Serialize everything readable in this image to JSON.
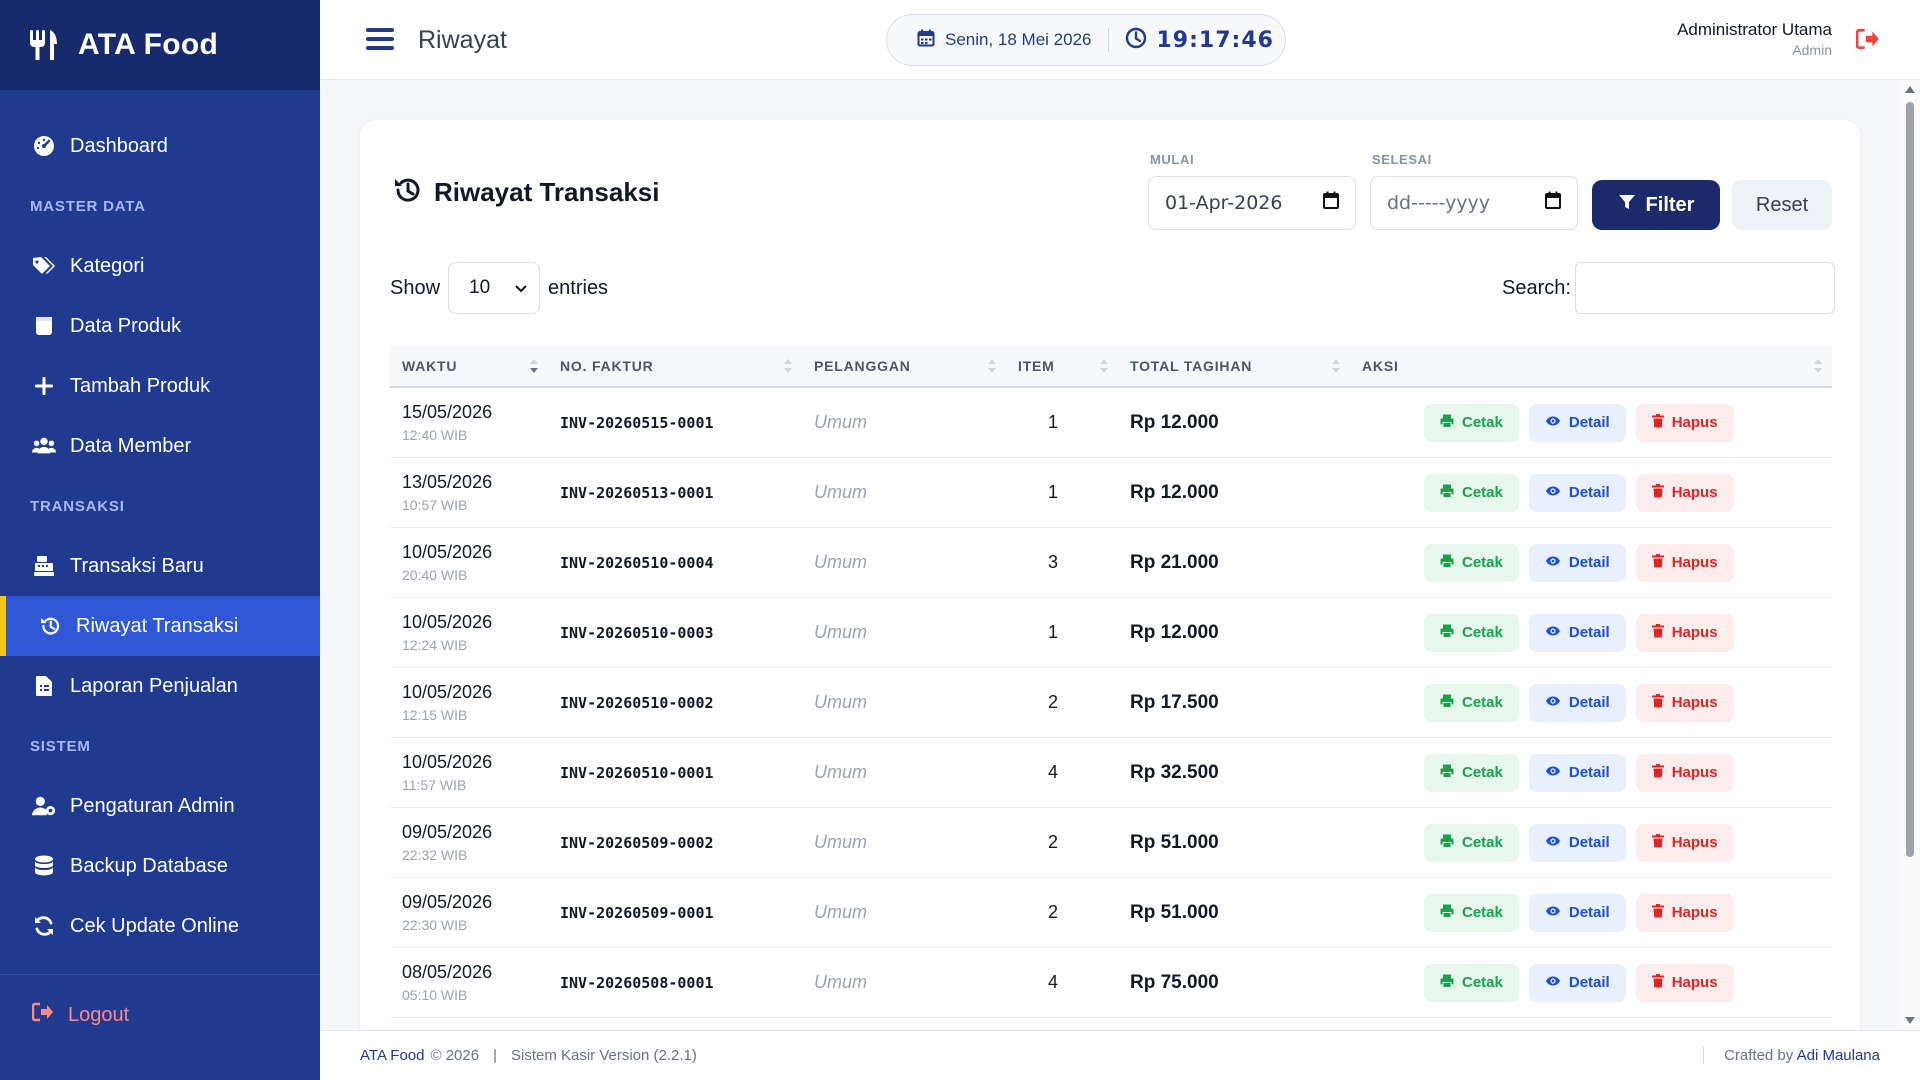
{
  "brand": {
    "name": "ATA Food",
    "icon": "utensils-icon"
  },
  "sidebar": {
    "items": [
      {
        "type": "item",
        "label": "Dashboard",
        "icon": "dashboard-icon"
      },
      {
        "type": "section",
        "label": "MASTER DATA"
      },
      {
        "type": "item",
        "label": "Kategori",
        "icon": "tags-icon"
      },
      {
        "type": "item",
        "label": "Data Produk",
        "icon": "box-icon"
      },
      {
        "type": "item",
        "label": "Tambah Produk",
        "icon": "plus-icon"
      },
      {
        "type": "item",
        "label": "Data Member",
        "icon": "users-icon"
      },
      {
        "type": "section",
        "label": "TRANSAKSI"
      },
      {
        "type": "item",
        "label": "Transaksi Baru",
        "icon": "cash-register-icon"
      },
      {
        "type": "item",
        "label": "Riwayat Transaksi",
        "icon": "history-icon",
        "active": true
      },
      {
        "type": "item",
        "label": "Laporan Penjualan",
        "icon": "file-report-icon"
      },
      {
        "type": "section",
        "label": "SISTEM"
      },
      {
        "type": "item",
        "label": "Pengaturan Admin",
        "icon": "user-gear-icon"
      },
      {
        "type": "item",
        "label": "Backup Database",
        "icon": "database-icon"
      },
      {
        "type": "item",
        "label": "Cek Update Online",
        "icon": "sync-icon"
      }
    ],
    "logout_label": "Logout"
  },
  "topbar": {
    "title": "Riwayat",
    "date": "Senin, 18 Mei 2026",
    "time": "19:17:46",
    "user_name": "Administrator Utama",
    "user_role": "Admin"
  },
  "card": {
    "title": "Riwayat Transaksi",
    "start_label": "MULAI",
    "start_value": "01-Apr-2026",
    "end_label": "SELESAI",
    "end_placeholder": "dd-----yyyy",
    "filter_label": "Filter",
    "reset_label": "Reset",
    "show_label": "Show",
    "entries_value": "10",
    "entries_label": "entries",
    "search_label": "Search:"
  },
  "table": {
    "headers": [
      "WAKTU",
      "NO. FAKTUR",
      "PELANGGAN",
      "ITEM",
      "TOTAL TAGIHAN",
      "AKSI"
    ],
    "action_labels": {
      "print": "Cetak",
      "detail": "Detail",
      "delete": "Hapus"
    },
    "rows": [
      {
        "date": "15/05/2026",
        "time": "12:40 WIB",
        "invoice": "INV-20260515-0001",
        "customer": "Umum",
        "items": "1",
        "total": "Rp 12.000"
      },
      {
        "date": "13/05/2026",
        "time": "10:57 WIB",
        "invoice": "INV-20260513-0001",
        "customer": "Umum",
        "items": "1",
        "total": "Rp 12.000"
      },
      {
        "date": "10/05/2026",
        "time": "20:40 WIB",
        "invoice": "INV-20260510-0004",
        "customer": "Umum",
        "items": "3",
        "total": "Rp 21.000"
      },
      {
        "date": "10/05/2026",
        "time": "12:24 WIB",
        "invoice": "INV-20260510-0003",
        "customer": "Umum",
        "items": "1",
        "total": "Rp 12.000"
      },
      {
        "date": "10/05/2026",
        "time": "12:15 WIB",
        "invoice": "INV-20260510-0002",
        "customer": "Umum",
        "items": "2",
        "total": "Rp 17.500"
      },
      {
        "date": "10/05/2026",
        "time": "11:57 WIB",
        "invoice": "INV-20260510-0001",
        "customer": "Umum",
        "items": "4",
        "total": "Rp 32.500"
      },
      {
        "date": "09/05/2026",
        "time": "22:32 WIB",
        "invoice": "INV-20260509-0002",
        "customer": "Umum",
        "items": "2",
        "total": "Rp 51.000"
      },
      {
        "date": "09/05/2026",
        "time": "22:30 WIB",
        "invoice": "INV-20260509-0001",
        "customer": "Umum",
        "items": "2",
        "total": "Rp 51.000"
      },
      {
        "date": "08/05/2026",
        "time": "05:10 WIB",
        "invoice": "INV-20260508-0001",
        "customer": "Umum",
        "items": "4",
        "total": "Rp 75.000"
      }
    ]
  },
  "footer": {
    "brand": "ATA Food",
    "copyright": "© 2026",
    "separator": "|",
    "version": "Sistem Kasir Version (2.2.1)",
    "crafted_label": "Crafted by",
    "author": "Adi Maulana"
  },
  "colors": {
    "sidebar": "#1f3a8f",
    "sidebar_active": "#2f57d6",
    "active_marker": "#f5c518",
    "primary_dark": "#1b2a6b",
    "success": "#16a34a",
    "info": "#1d4ed8",
    "danger": "#dc2626"
  }
}
